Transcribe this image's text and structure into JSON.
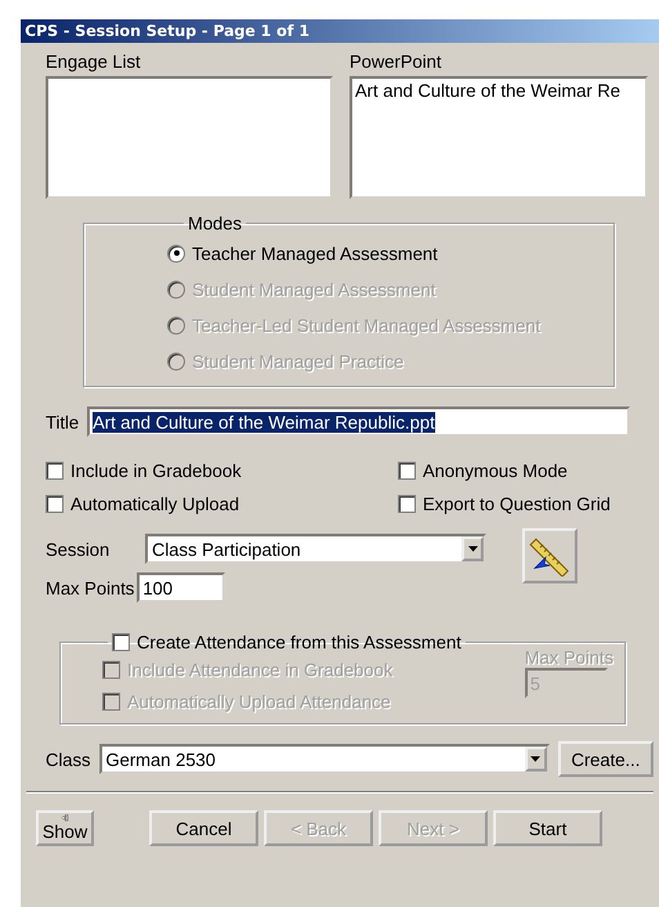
{
  "window": {
    "title": "CPS - Session Setup - Page 1 of 1"
  },
  "engage_list": {
    "label": "Engage List"
  },
  "powerpoint": {
    "label": "PowerPoint",
    "items": [
      "Art and Culture of the Weimar Re"
    ]
  },
  "modes": {
    "label": "Modes",
    "options": [
      {
        "label": "Teacher Managed Assessment",
        "selected": true,
        "disabled": false
      },
      {
        "label": "Student Managed Assessment",
        "selected": false,
        "disabled": true
      },
      {
        "label": "Teacher-Led Student Managed Assessment",
        "selected": false,
        "disabled": true
      },
      {
        "label": "Student Managed Practice",
        "selected": false,
        "disabled": true
      }
    ]
  },
  "title_field": {
    "label": "Title",
    "value": "Art and Culture of the Weimar Republic.ppt",
    "highlighted": true
  },
  "options": [
    {
      "label": "Include in Gradebook",
      "checked": false
    },
    {
      "label": "Anonymous Mode",
      "checked": false
    },
    {
      "label": "Automatically Upload",
      "checked": false
    },
    {
      "label": "Export to Question Grid",
      "checked": false
    }
  ],
  "session": {
    "label": "Session",
    "value": "Class Participation"
  },
  "max_points": {
    "label": "Max Points",
    "value": "100"
  },
  "attendance": {
    "label": "Create Attendance from this Assessment",
    "checked": false,
    "options": [
      {
        "label": "Include Attendance in Gradebook",
        "checked": false,
        "disabled": true
      },
      {
        "label": "Automatically Upload Attendance",
        "checked": false,
        "disabled": true
      }
    ],
    "max_points": {
      "label": "Max Points",
      "value": "5",
      "disabled": true
    }
  },
  "class": {
    "label": "Class",
    "value": "German 2530",
    "button": "Create..."
  },
  "buttons": [
    {
      "label": "Show",
      "kind": "show"
    },
    {
      "label": "Cancel",
      "kind": "push",
      "disabled": false
    },
    {
      "label": "< Back",
      "kind": "push",
      "disabled": true
    },
    {
      "label": "Next >",
      "kind": "push",
      "disabled": true
    },
    {
      "label": "Start",
      "kind": "push",
      "disabled": false
    }
  ]
}
